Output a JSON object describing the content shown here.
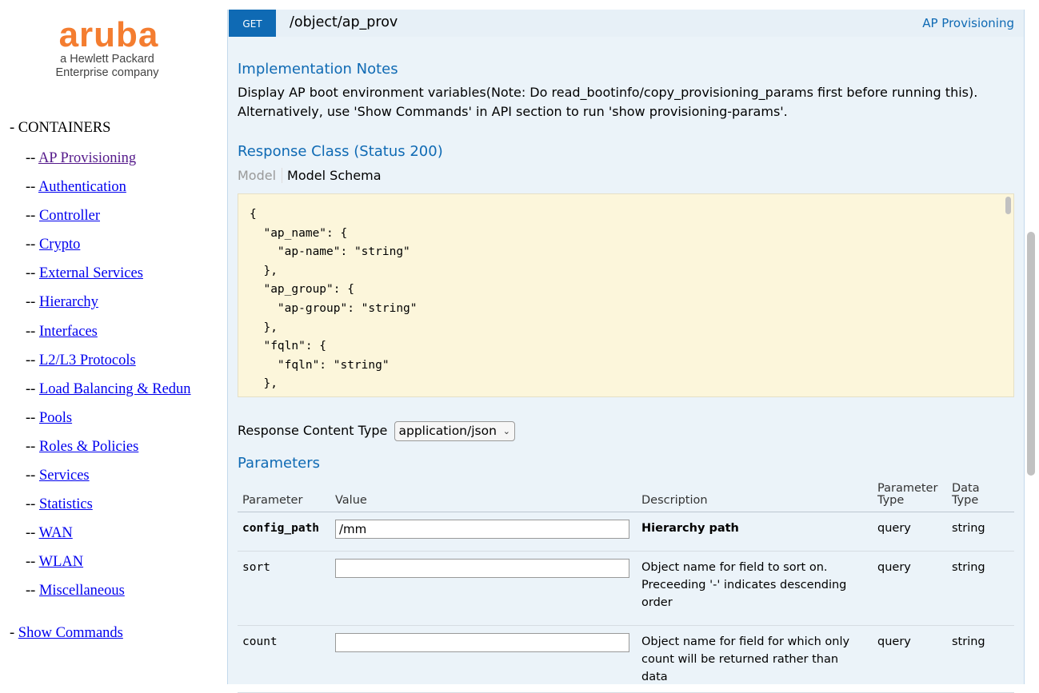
{
  "logo": {
    "brand": "aruba",
    "tagline_1": "a Hewlett Packard",
    "tagline_2": "Enterprise company",
    "brand_color": "#f47d30"
  },
  "sidebar": {
    "containers_label": "- CONTAINERS",
    "items": [
      {
        "prefix": "-- ",
        "label": "AP Provisioning",
        "visited": true
      },
      {
        "prefix": "-- ",
        "label": "Authentication"
      },
      {
        "prefix": "-- ",
        "label": "Controller"
      },
      {
        "prefix": "-- ",
        "label": "Crypto"
      },
      {
        "prefix": "-- ",
        "label": "External Services"
      },
      {
        "prefix": "-- ",
        "label": "Hierarchy"
      },
      {
        "prefix": "-- ",
        "label": "Interfaces"
      },
      {
        "prefix": "-- ",
        "label": "L2/L3 Protocols"
      },
      {
        "prefix": "-- ",
        "label": "Load Balancing & Redun"
      },
      {
        "prefix": "-- ",
        "label": "Pools"
      },
      {
        "prefix": "-- ",
        "label": "Roles & Policies"
      },
      {
        "prefix": "-- ",
        "label": "Services"
      },
      {
        "prefix": "-- ",
        "label": "Statistics"
      },
      {
        "prefix": "-- ",
        "label": "WAN"
      },
      {
        "prefix": "-- ",
        "label": "WLAN"
      },
      {
        "prefix": "-- ",
        "label": "Miscellaneous"
      }
    ],
    "show_commands_prefix": "- ",
    "show_commands_label": "Show Commands"
  },
  "operation": {
    "method": "GET",
    "path": "/object/ap_prov",
    "tag": "AP Provisioning",
    "method_color": "#0f6ab4"
  },
  "implementation": {
    "title": "Implementation Notes",
    "line_1": "Display AP boot environment variables(Note: Do read_bootinfo/copy_provisioning_params first before running this).",
    "line_2": "Alternatively, use 'Show Commands' in API section to run 'show provisioning-params'."
  },
  "response_class": {
    "title": "Response Class (Status 200)",
    "tab_model": "Model",
    "tab_schema": "Model Schema",
    "schema_text": "{\n  \"ap_name\": {\n    \"ap-name\": \"string\"\n  },\n  \"ap_group\": {\n    \"ap-group\": \"string\"\n  },\n  \"fqln\": {\n    \"fqln\": \"string\"\n  },"
  },
  "response_content_type": {
    "label": "Response Content Type",
    "selected": "application/json"
  },
  "parameters": {
    "title": "Parameters",
    "headers": {
      "parameter": "Parameter",
      "value": "Value",
      "description": "Description",
      "param_type_1": "Parameter",
      "param_type_2": "Type",
      "data_type": "Data Type"
    },
    "rows": [
      {
        "name": "config_path",
        "value": "/mm",
        "description": "Hierarchy path",
        "param_type": "query",
        "data_type": "string"
      },
      {
        "name": "sort",
        "value": "",
        "description": "Object name for field to sort on. Preceeding '-' indicates descending order",
        "param_type": "query",
        "data_type": "string"
      },
      {
        "name": "count",
        "value": "",
        "description": "Object name for field for which only count will be returned rather than data",
        "param_type": "query",
        "data_type": "string"
      }
    ]
  }
}
